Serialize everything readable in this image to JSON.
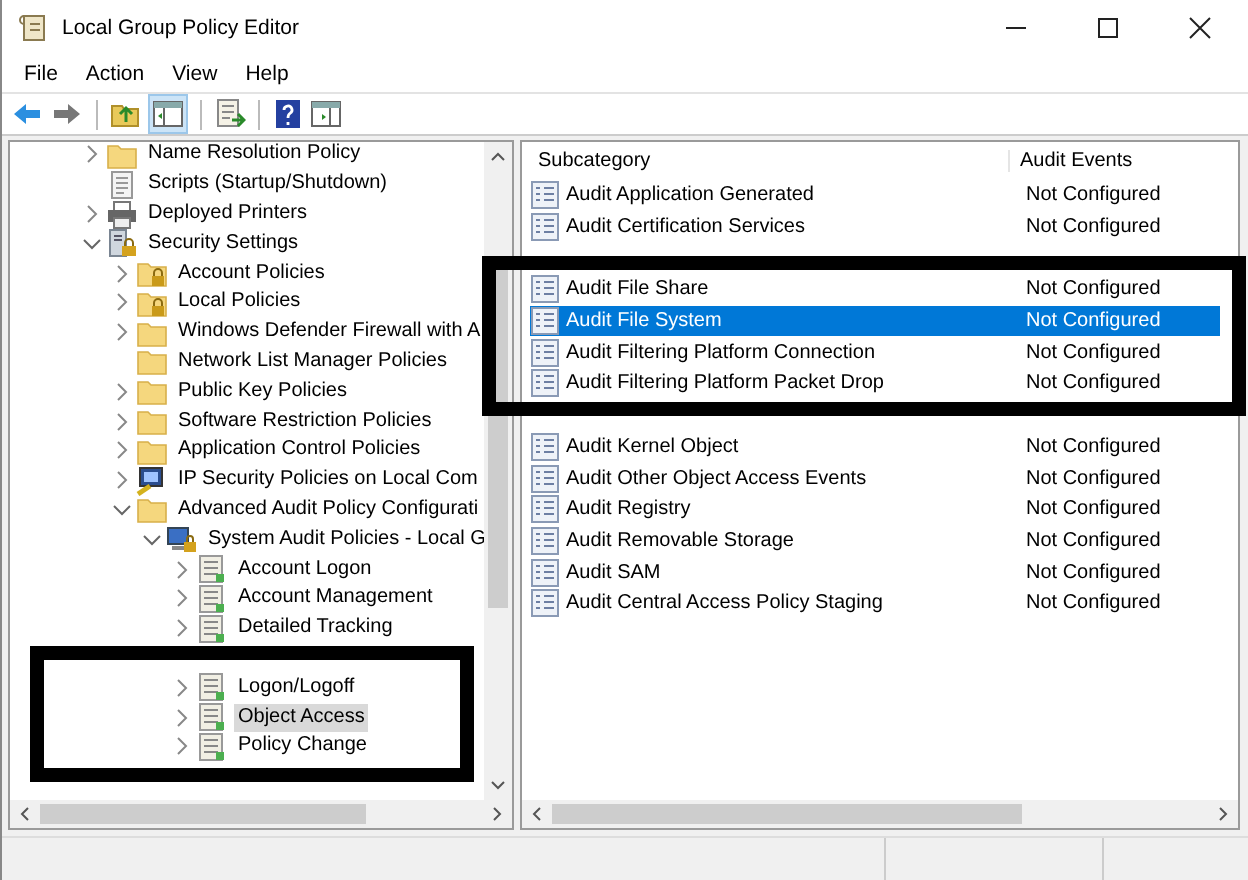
{
  "window": {
    "title": "Local Group Policy Editor"
  },
  "menu": [
    "File",
    "Action",
    "View",
    "Help"
  ],
  "tree": [
    {
      "label": "Name Resolution Policy",
      "kind": "folder",
      "expanded": false
    },
    {
      "label": "Scripts (Startup/Shutdown)",
      "kind": "script"
    },
    {
      "label": "Deployed Printers",
      "kind": "printer",
      "expanded": false
    },
    {
      "label": "Security Settings",
      "kind": "security",
      "expanded": true,
      "children": [
        {
          "label": "Account Policies",
          "kind": "lock-folder",
          "expanded": false
        },
        {
          "label": "Local Policies",
          "kind": "lock-folder",
          "expanded": false
        },
        {
          "label": "Windows Defender Firewall with A",
          "kind": "folder",
          "expanded": false
        },
        {
          "label": "Network List Manager Policies",
          "kind": "folder"
        },
        {
          "label": "Public Key Policies",
          "kind": "folder",
          "expanded": false
        },
        {
          "label": "Software Restriction Policies",
          "kind": "folder",
          "expanded": false
        },
        {
          "label": "Application Control Policies",
          "kind": "folder",
          "expanded": false
        },
        {
          "label": "IP Security Policies on Local Com",
          "kind": "ip-security",
          "expanded": false
        },
        {
          "label": "Advanced Audit Policy Configurati",
          "kind": "folder",
          "expanded": true,
          "children": [
            {
              "label": "System Audit Policies - Local G",
              "kind": "audit-root",
              "expanded": true,
              "children": [
                {
                  "label": "Account Logon",
                  "kind": "category",
                  "expanded": false,
                  "selected": false
                },
                {
                  "label": "Account Management",
                  "kind": "category",
                  "expanded": false,
                  "selected": false
                },
                {
                  "label": "Detailed Tracking",
                  "kind": "category",
                  "expanded": false,
                  "selected": false
                },
                {
                  "kind": "covered"
                },
                {
                  "label": "Logon/Logoff",
                  "kind": "category",
                  "expanded": false,
                  "selected": false
                },
                {
                  "label": "Object Access",
                  "kind": "category",
                  "expanded": false,
                  "selected": true
                },
                {
                  "label": "Policy Change",
                  "kind": "category",
                  "expanded": false,
                  "selected": false
                },
                {
                  "kind": "covered"
                }
              ]
            }
          ]
        }
      ]
    }
  ],
  "list": {
    "columns": [
      "Subcategory",
      "Audit Events"
    ],
    "rows": [
      {
        "subcategory": "Audit Application Generated",
        "audit_events": "Not Configured",
        "selected": false
      },
      {
        "subcategory": "Audit Certification Services",
        "audit_events": "Not Configured",
        "selected": false
      },
      {
        "kind": "covered"
      },
      {
        "subcategory": "Audit File Share",
        "audit_events": "Not Configured",
        "selected": false
      },
      {
        "subcategory": "Audit File System",
        "audit_events": "Not Configured",
        "selected": true
      },
      {
        "subcategory": "Audit Filtering Platform Connection",
        "audit_events": "Not Configured",
        "selected": false
      },
      {
        "subcategory": "Audit Filtering Platform Packet Drop",
        "audit_events": "Not Configured",
        "selected": false
      },
      {
        "kind": "covered"
      },
      {
        "subcategory": "Audit Kernel Object",
        "audit_events": "Not Configured",
        "selected": false
      },
      {
        "subcategory": "Audit Other Object Access Events",
        "audit_events": "Not Configured",
        "selected": false
      },
      {
        "subcategory": "Audit Registry",
        "audit_events": "Not Configured",
        "selected": false
      },
      {
        "subcategory": "Audit Removable Storage",
        "audit_events": "Not Configured",
        "selected": false
      },
      {
        "subcategory": "Audit SAM",
        "audit_events": "Not Configured",
        "selected": false
      },
      {
        "subcategory": "Audit Central Access Policy Staging",
        "audit_events": "Not Configured",
        "selected": false
      }
    ]
  }
}
